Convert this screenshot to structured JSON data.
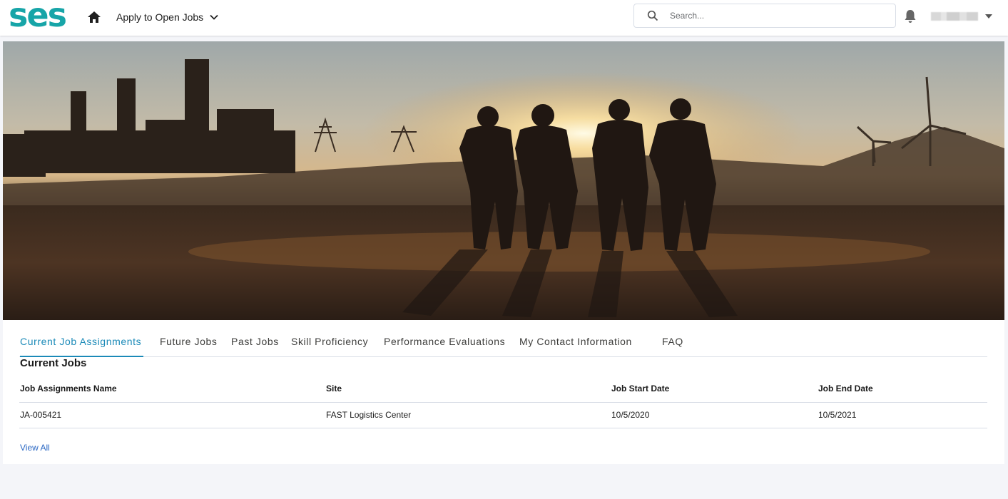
{
  "brand": {
    "logo_text": "ses",
    "color": "#17a5a8"
  },
  "header": {
    "nav_label": "Apply to Open Jobs",
    "search_placeholder": "Search...",
    "icons": [
      "home-icon",
      "chevron-down-icon",
      "search-icon",
      "bell-icon",
      "caret-down-icon"
    ]
  },
  "tabs": [
    {
      "label": "Current Job Assignments",
      "active": true
    },
    {
      "label": "Future Jobs"
    },
    {
      "label": "Past Jobs"
    },
    {
      "label": "Skill Proficiency"
    },
    {
      "label": "Performance Evaluations"
    },
    {
      "label": "My Contact Information"
    },
    {
      "label": "FAQ"
    }
  ],
  "section": {
    "title": "Current Jobs"
  },
  "table": {
    "columns": [
      "Job Assignments Name",
      "Site",
      "Job Start Date",
      "Job End Date"
    ],
    "rows": [
      [
        "JA-005421",
        "FAST Logistics Center",
        "10/5/2020",
        "10/5/2021"
      ]
    ]
  },
  "view_all_label": "View All",
  "colors": {
    "accent": "#1b8ab8",
    "link": "#2a67c3"
  }
}
